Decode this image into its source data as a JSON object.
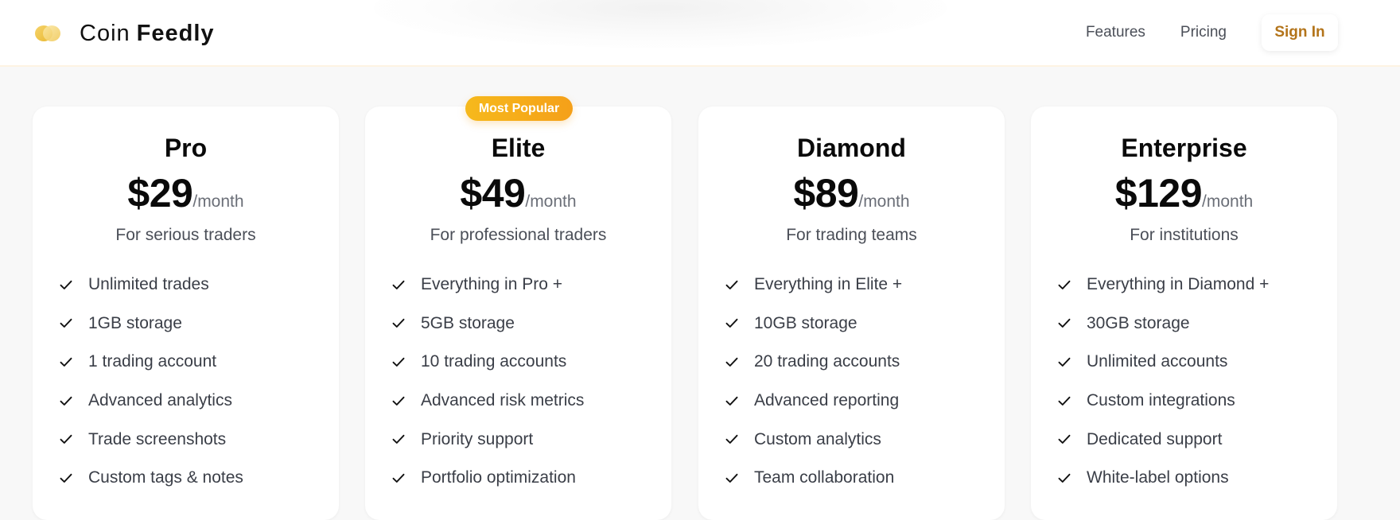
{
  "brand": {
    "name_light": "Coin",
    "name_bold": "Feedly"
  },
  "nav": {
    "features": "Features",
    "pricing": "Pricing",
    "sign_in": "Sign In"
  },
  "badge": "Most Popular",
  "plans": [
    {
      "name": "Pro",
      "price": "$29",
      "period": "/month",
      "tagline": "For serious traders",
      "features": [
        "Unlimited trades",
        "1GB storage",
        "1 trading account",
        "Advanced analytics",
        "Trade screenshots",
        "Custom tags & notes"
      ]
    },
    {
      "name": "Elite",
      "price": "$49",
      "period": "/month",
      "tagline": "For professional traders",
      "features": [
        "Everything in Pro +",
        "5GB storage",
        "10 trading accounts",
        "Advanced risk metrics",
        "Priority support",
        "Portfolio optimization"
      ]
    },
    {
      "name": "Diamond",
      "price": "$89",
      "period": "/month",
      "tagline": "For trading teams",
      "features": [
        "Everything in Elite +",
        "10GB storage",
        "20 trading accounts",
        "Advanced reporting",
        "Custom analytics",
        "Team collaboration"
      ]
    },
    {
      "name": "Enterprise",
      "price": "$129",
      "period": "/month",
      "tagline": "For institutions",
      "features": [
        "Everything in Diamond +",
        "30GB storage",
        "Unlimited accounts",
        "Custom integrations",
        "Dedicated support",
        "White-label options"
      ]
    }
  ],
  "colors": {
    "accent": "#b3741a",
    "badge_start": "#f6b91c",
    "badge_end": "#f5a019"
  },
  "icons": {
    "logo": "coin-logo-icon",
    "feature": "check-icon"
  }
}
